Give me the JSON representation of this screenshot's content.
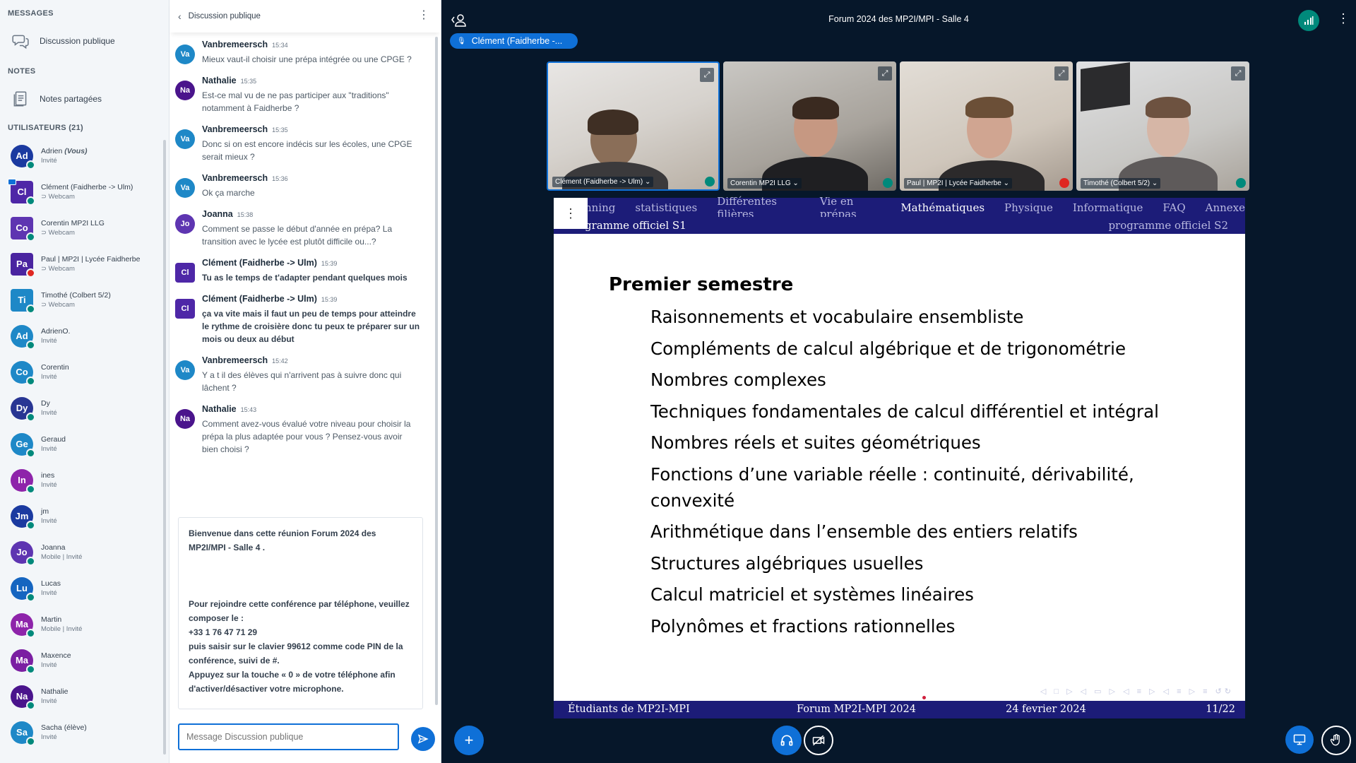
{
  "sidebar": {
    "messages_title": "MESSAGES",
    "public_chat": "Discussion publique",
    "notes_title": "NOTES",
    "shared_notes": "Notes partagées",
    "users_title": "UTILISATEURS (21)",
    "users": [
      {
        "initials": "Ad",
        "name": "Adrien",
        "you": "(Vous)",
        "role": "Invité",
        "color": "#1b3aa0",
        "status": "ok"
      },
      {
        "initials": "Cl",
        "name": "Clément (Faidherbe -> Ulm)",
        "role": "⊃ Webcam",
        "color": "#4e27a7",
        "status": "ok",
        "square": true,
        "presenter": true
      },
      {
        "initials": "Co",
        "name": "Corentin MP2I LLG",
        "role": "⊃ Webcam",
        "color": "#5e35b1",
        "status": "ok",
        "square": true
      },
      {
        "initials": "Pa",
        "name": "Paul | MP2I | Lycée Faidherbe",
        "role": "⊃ Webcam",
        "color": "#4a24a0",
        "status": "muted",
        "square": true
      },
      {
        "initials": "Ti",
        "name": "Timothé (Colbert 5/2)",
        "role": "⊃ Webcam",
        "color": "#1e88c7",
        "status": "ok",
        "square": true
      },
      {
        "initials": "Ad",
        "name": "AdrienO.",
        "role": "Invité",
        "color": "#1e88c7",
        "status": "ok"
      },
      {
        "initials": "Co",
        "name": "Corentin",
        "role": "Invité",
        "color": "#1e88c7",
        "status": "ok"
      },
      {
        "initials": "Dy",
        "name": "Dy",
        "role": "Invité",
        "color": "#283593",
        "status": "ok"
      },
      {
        "initials": "Ge",
        "name": "Geraud",
        "role": "Invité",
        "color": "#1e88c7",
        "status": "ok"
      },
      {
        "initials": "In",
        "name": "ines",
        "role": "Invité",
        "color": "#8e24aa",
        "status": "ok"
      },
      {
        "initials": "Jm",
        "name": "jm",
        "role": "Invité",
        "color": "#1b3aa0",
        "status": "ok"
      },
      {
        "initials": "Jo",
        "name": "Joanna",
        "role": "Mobile | Invité",
        "color": "#5e35b1",
        "status": "ok"
      },
      {
        "initials": "Lu",
        "name": "Lucas",
        "role": "Invité",
        "color": "#1565c0",
        "status": "ok"
      },
      {
        "initials": "Ma",
        "name": "Martin",
        "role": "Mobile | Invité",
        "color": "#8e24aa",
        "status": "ok"
      },
      {
        "initials": "Ma",
        "name": "Maxence",
        "role": "Invité",
        "color": "#7b1fa2",
        "status": "ok"
      },
      {
        "initials": "Na",
        "name": "Nathalie",
        "role": "Invité",
        "color": "#4a148c",
        "status": "ok"
      },
      {
        "initials": "Sa",
        "name": "Sacha (élève)",
        "role": "Invité",
        "color": "#1e88c7",
        "status": "ok"
      }
    ]
  },
  "chat": {
    "title": "Discussion publique",
    "messages": [
      {
        "initials": "Va",
        "author": "Vanbremeersch",
        "time": "15:34",
        "text": "Mieux vaut-il choisir une prépa intégrée ou une CPGE ?",
        "color": "#1e88c7"
      },
      {
        "initials": "Na",
        "author": "Nathalie",
        "time": "15:35",
        "text": "Est-ce mal vu de ne pas participer aux \"traditions\" notamment à Faidherbe ?",
        "color": "#4a148c"
      },
      {
        "initials": "Va",
        "author": "Vanbremeersch",
        "time": "15:35",
        "text": "Donc si on est encore indécis sur les écoles, une CPGE serait mieux ?",
        "color": "#1e88c7"
      },
      {
        "initials": "Va",
        "author": "Vanbremeersch",
        "time": "15:36",
        "text": "Ok ça marche",
        "color": "#1e88c7"
      },
      {
        "initials": "Jo",
        "author": "Joanna",
        "time": "15:38",
        "text": "Comment se passe le début d'année en prépa? La transition avec le lycée est plutôt difficile ou...?",
        "color": "#5e35b1"
      },
      {
        "initials": "Cl",
        "author": "Clément (Faidherbe -> Ulm)",
        "time": "15:39",
        "text": "Tu as le temps de t'adapter pendant quelques mois",
        "color": "#4e27a7",
        "bold": true,
        "square": true
      },
      {
        "initials": "Cl",
        "author": "Clément (Faidherbe -> Ulm)",
        "time": "15:39",
        "text": "ça va vite mais il faut un peu de temps pour atteindre le rythme de croisière donc tu peux te préparer sur un mois ou deux au début",
        "color": "#4e27a7",
        "bold": true,
        "square": true
      },
      {
        "initials": "Va",
        "author": "Vanbremeersch",
        "time": "15:42",
        "text": "Y a t il des élèves qui n'arrivent pas à suivre donc qui lâchent ?",
        "color": "#1e88c7"
      },
      {
        "initials": "Na",
        "author": "Nathalie",
        "time": "15:43",
        "text": "Comment avez-vous évalué votre niveau pour choisir la prépa la plus adaptée pour vous ? Pensez-vous avoir bien choisi ?",
        "color": "#4a148c"
      }
    ],
    "welcome": {
      "line1": "Bienvenue dans cette réunion Forum 2024 des MP2I/MPI - Salle 4 .",
      "line2": "Pour rejoindre cette conférence par téléphone, veuillez composer le :",
      "phone": "+33 1 76 47 71 29",
      "line3": "puis saisir sur le clavier 99612 comme code PIN de la conférence, suivi de #.",
      "line4": "Appuyez sur la touche « 0 » de votre téléphone afin d'activer/désactiver votre microphone."
    },
    "input_placeholder": "Message Discussion publique"
  },
  "main": {
    "title": "Forum 2024 des MP2I/MPI - Salle 4",
    "talking": "Clément (Faidherbe -...",
    "cams": [
      {
        "label": "Clément (Faidherbe -> Ulm) ⌄",
        "status": "ok"
      },
      {
        "label": "Corentin MP2I LLG ⌄",
        "status": "ok"
      },
      {
        "label": "Paul | MP2I | Lycée Faidherbe ⌄",
        "status": "muted"
      },
      {
        "label": "Timothé (Colbert 5/2) ⌄",
        "status": "ok"
      }
    ]
  },
  "slide": {
    "nav": [
      "nning",
      "statistiques",
      "Différentes filières",
      "Vie en prépas",
      "Mathématiques",
      "Physique",
      "Informatique",
      "FAQ",
      "Annexe"
    ],
    "nav_current": 4,
    "sub_left": "gramme officiel S1",
    "sub_right": "programme officiel S2",
    "title": "Premier semestre",
    "items": [
      "Raisonnements et vocabulaire ensembliste",
      "Compléments de calcul algébrique et de trigonométrie",
      "Nombres complexes",
      "Techniques fondamentales de calcul différentiel et intégral",
      "Nombres réels et suites géométriques",
      "Fonctions d’une variable réelle : continuité, dérivabilité, convexité",
      "Arithmétique dans l’ensemble des entiers relatifs",
      "Structures algébriques usuelles",
      "Calcul matriciel et systèmes linéaires",
      "Polynômes et fractions rationnelles"
    ],
    "footer": {
      "left": "Étudiants de MP2I-MPI",
      "center": "Forum MP2I-MPI 2024",
      "date": "24 fevrier 2024",
      "page": "11/22"
    }
  }
}
